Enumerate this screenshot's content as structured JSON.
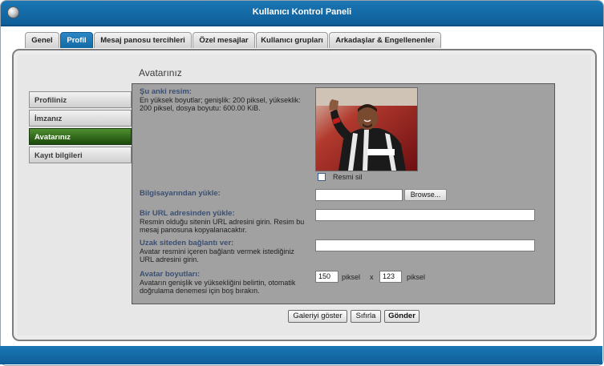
{
  "window": {
    "title": "Kullanıcı Kontrol Paneli"
  },
  "tabs": [
    {
      "label": "Genel",
      "active": false
    },
    {
      "label": "Profil",
      "active": true
    },
    {
      "label": "Mesaj panosu tercihleri",
      "active": false
    },
    {
      "label": "Özel mesajlar",
      "active": false
    },
    {
      "label": "Kullanıcı grupları",
      "active": false
    },
    {
      "label": "Arkadaşlar & Engellenenler",
      "active": false
    }
  ],
  "sidebar": {
    "items": [
      {
        "label": "Profiliniz",
        "active": false
      },
      {
        "label": "İmzanız",
        "active": false
      },
      {
        "label": "Avatarınız",
        "active": true
      },
      {
        "label": "Kayıt bilgileri",
        "active": false
      }
    ]
  },
  "main": {
    "title": "Avatarınız",
    "current": {
      "label": "Şu anki resim:",
      "desc": "En yüksek boyutlar; genişlik: 200 piksel, yükseklik: 200 piksel, dosya boyutu: 600.00 KiB.",
      "delete_label": "Resmi sil",
      "delete_checked": false
    },
    "upload": {
      "label": "Bilgisayarından yükle:",
      "value": "",
      "browse_label": "Browse..."
    },
    "url_upload": {
      "label": "Bir URL adresinden yükle:",
      "desc": "Resmin olduğu sitenin URL adresini girin. Resim bu mesaj panosuna kopyalanacaktır.",
      "value": ""
    },
    "remote_link": {
      "label": "Uzak siteden bağlantı ver:",
      "desc": "Avatar resmini içeren bağlantı vermek istediğiniz URL adresini girin.",
      "value": ""
    },
    "dimensions": {
      "label": "Avatar boyutları:",
      "desc": "Avatarın genişlik ve yüksekliğini belirtin, otomatik doğrulama denemesi için boş bırakın.",
      "width": "150",
      "height": "123",
      "unit": "piksel",
      "separator": "x"
    }
  },
  "buttons": {
    "gallery": "Galeriyi göster",
    "reset": "Sıfırla",
    "submit": "Gönder"
  },
  "colors": {
    "accent": "#136aa5",
    "active_sidebar": "#2e6a18",
    "content_bg": "#a1a1a1",
    "label": "#3a4f73"
  }
}
